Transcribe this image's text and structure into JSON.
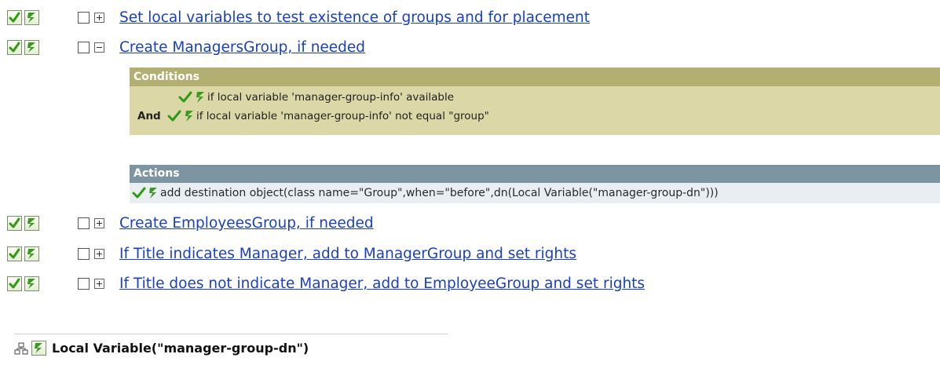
{
  "rules": [
    {
      "label": "Set local variables to test existence of groups and for placement",
      "expanded": false
    },
    {
      "label": "Create ManagersGroup, if needed",
      "expanded": true
    },
    {
      "label": "Create EmployeesGroup, if needed",
      "expanded": false
    },
    {
      "label": "If Title indicates Manager, add to ManagerGroup and set rights",
      "expanded": false
    },
    {
      "label": "If Title does not indicate Manager, add to EmployeeGroup and set rights",
      "expanded": false
    }
  ],
  "conditions": {
    "header": "Conditions",
    "items": [
      {
        "connector": "",
        "text": "if local variable 'manager-group-info' available"
      },
      {
        "connector": "And",
        "text": "if local variable 'manager-group-info' not equal \"group\""
      }
    ]
  },
  "actions": {
    "header": "Actions",
    "items": [
      {
        "text": "add destination object(class name=\"Group\",when=\"before\",dn(Local Variable(\"manager-group-dn\")))"
      }
    ]
  },
  "footer": {
    "text": "Local Variable(\"manager-group-dn\")"
  },
  "icons": {
    "enabled": "green-check-icon",
    "trace": "trace-lightning-icon",
    "expand": "plus-box-icon",
    "collapse": "minus-box-icon",
    "tree": "tree-structure-icon"
  },
  "colors": {
    "link": "#1a3fc0",
    "conditions_header": "#b3af73",
    "conditions_body": "#dbd7a6",
    "actions_header": "#7d94a3",
    "actions_body": "#e9eef2",
    "check": "#2f9a14"
  }
}
